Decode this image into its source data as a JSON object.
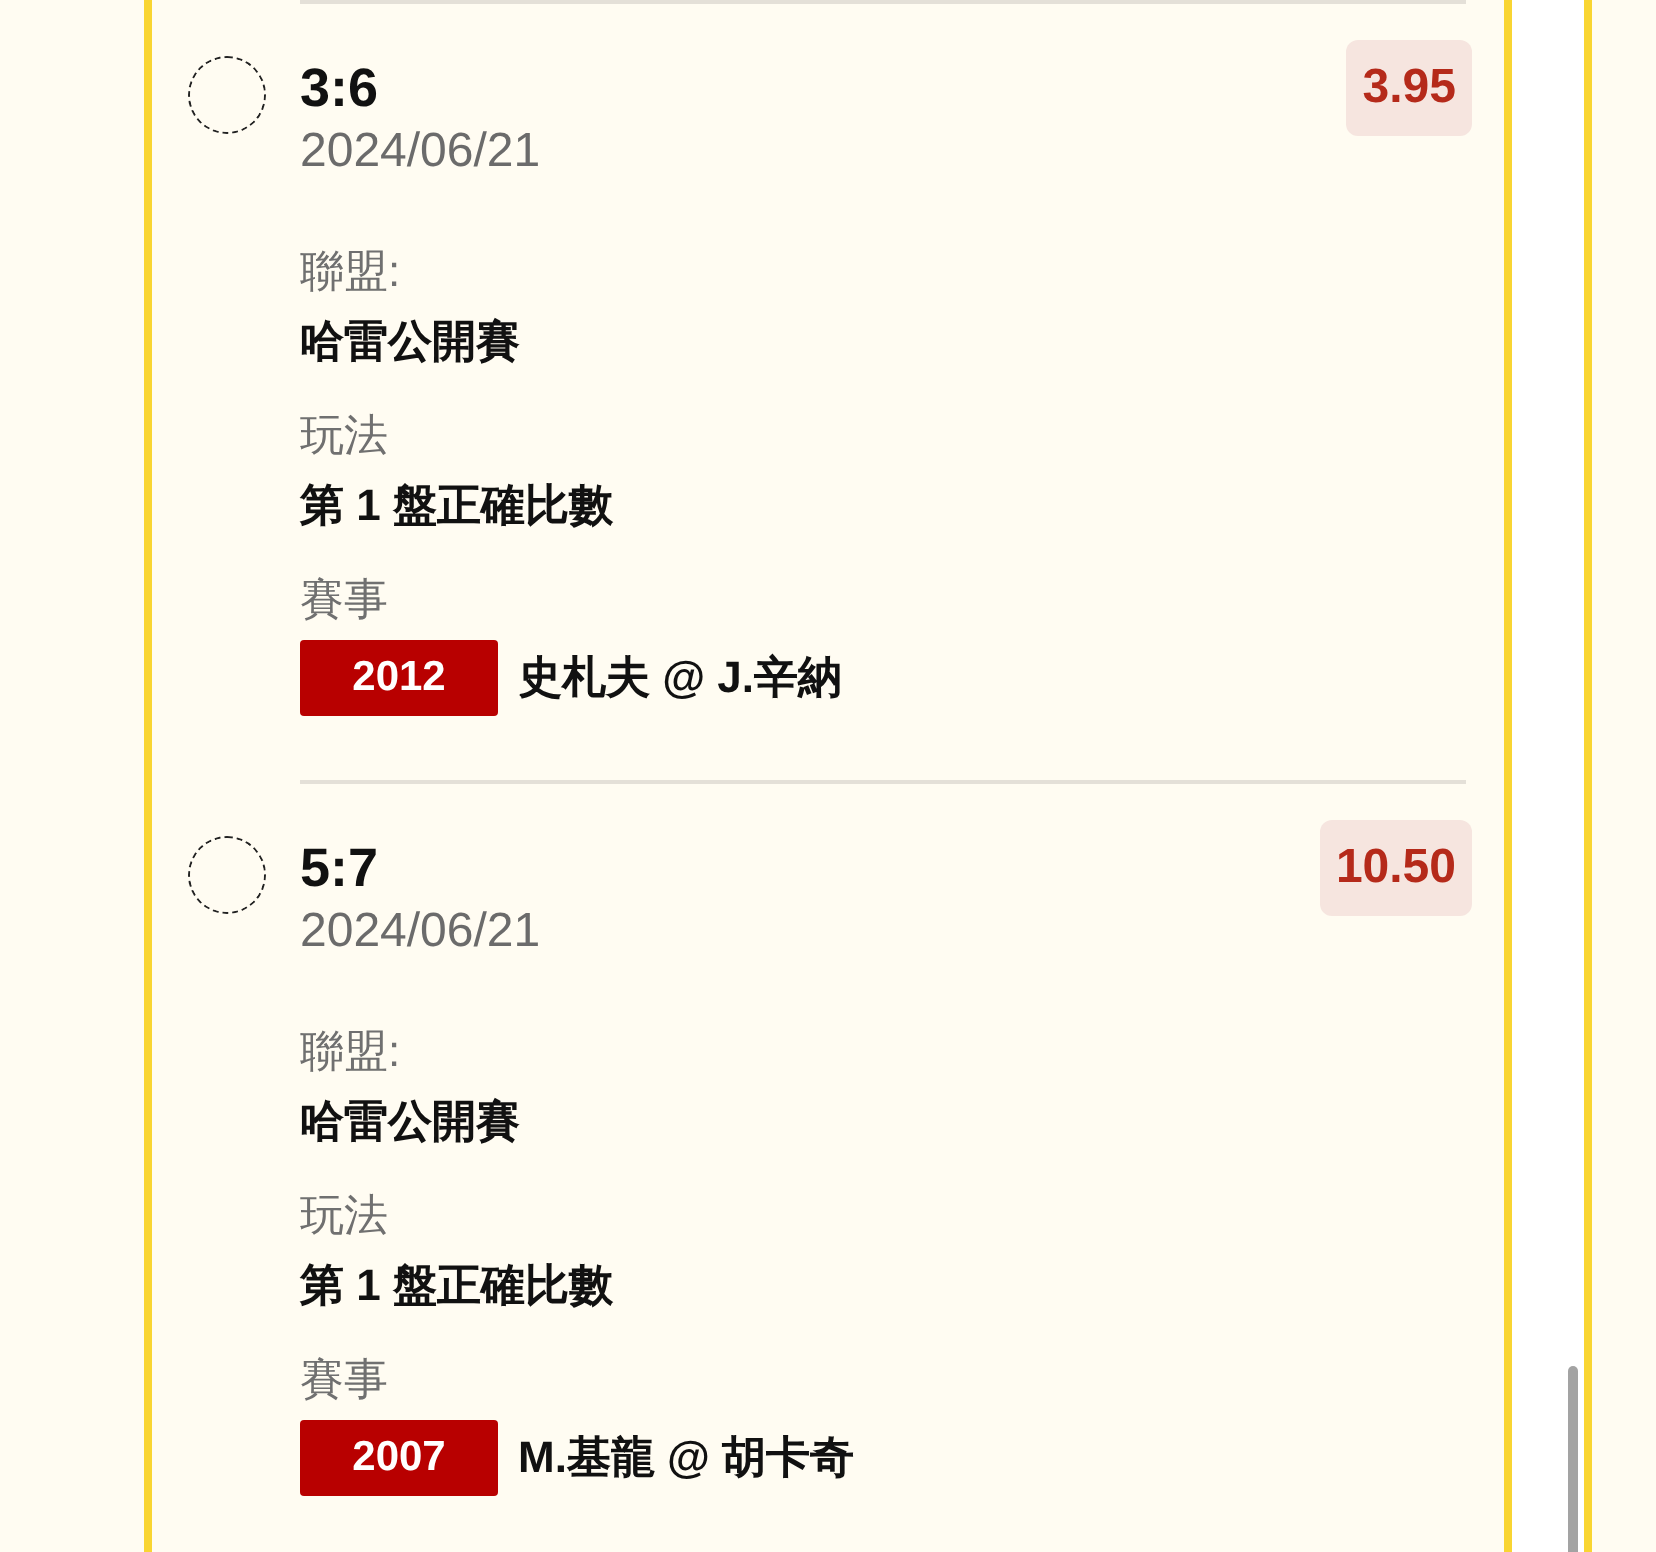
{
  "bets": [
    {
      "selected": false,
      "score": "3:6",
      "date": "2024/06/21",
      "odds": "3.95",
      "league_label": "聯盟:",
      "league": "哈雷公開賽",
      "market_label": "玩法",
      "market": "第 1 盤正確比數",
      "event_label": "賽事",
      "event_code": "2012",
      "event": "史札夫 @ J.辛納"
    },
    {
      "selected": false,
      "score": "5:7",
      "date": "2024/06/21",
      "odds": "10.50",
      "league_label": "聯盟:",
      "league": "哈雷公開賽",
      "market_label": "玩法",
      "market": "第 1 盤正確比數",
      "event_label": "賽事",
      "event_code": "2007",
      "event": "M.基龍 @ 胡卡奇"
    }
  ]
}
